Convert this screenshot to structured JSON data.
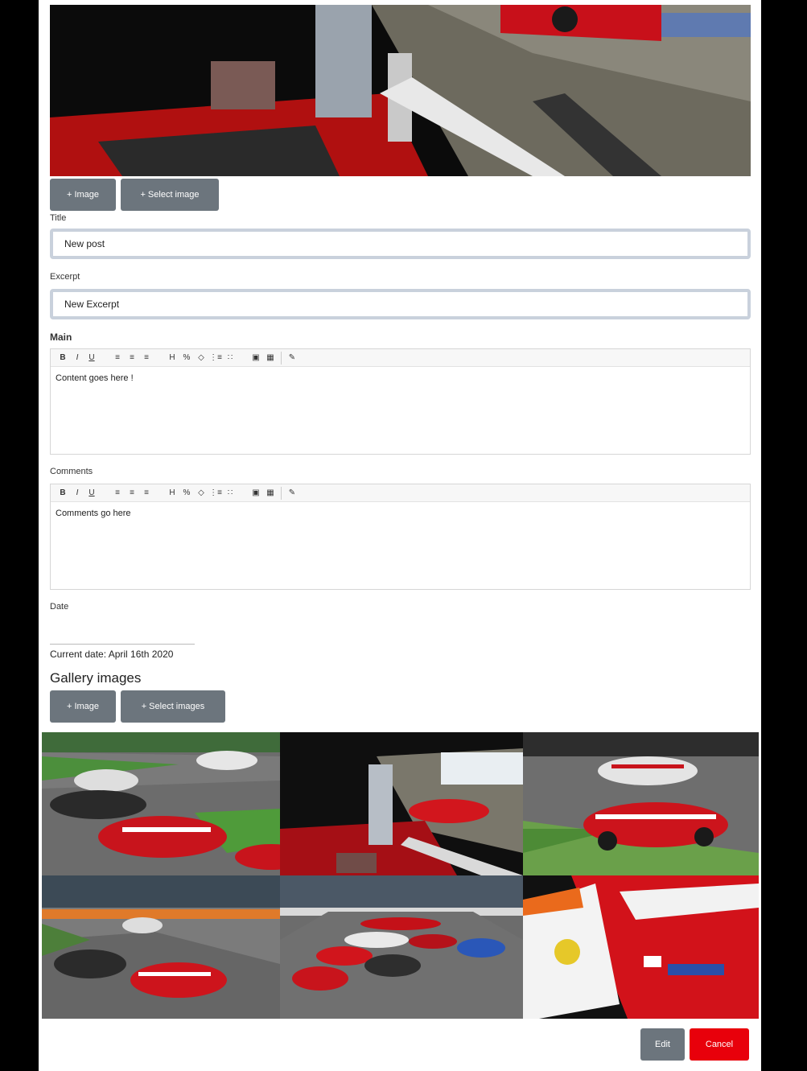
{
  "hero": {
    "alt": "pit-lane-photo"
  },
  "image_buttons": {
    "add_image": "+ Image",
    "select_image": "+ Select image"
  },
  "fields": {
    "title": {
      "label": "Title",
      "value": "New post"
    },
    "excerpt": {
      "label": "Excerpt",
      "value": "New Excerpt"
    }
  },
  "main_editor": {
    "label": "Main",
    "content": "Content goes here !"
  },
  "comments_editor": {
    "label": "Comments",
    "content": "Comments go here"
  },
  "toolbar_icons": [
    "bold",
    "italic",
    "underline",
    "align-left",
    "align-center",
    "align-right",
    "heading",
    "link",
    "code",
    "ordered-list",
    "unordered-list",
    "image",
    "table",
    "eraser"
  ],
  "toolbar_glyphs": {
    "bold": "B",
    "italic": "I",
    "underline": "U",
    "align-left": "≡",
    "align-center": "≡",
    "align-right": "≡",
    "heading": "H",
    "link": "%",
    "code": "◇",
    "ordered-list": "⋮≡",
    "unordered-list": "∷",
    "image": "▣",
    "table": "▦",
    "eraser": "✎"
  },
  "date": {
    "label": "Date",
    "current": "Current date: April 16th 2020"
  },
  "gallery": {
    "title": "Gallery images",
    "add_image": "+ Image",
    "select_images": "+ Select images"
  },
  "footer": {
    "edit": "Edit",
    "cancel": "Cancel"
  },
  "colors": {
    "button_gray": "#6c757d",
    "cancel_red": "#e8000b",
    "input_border": "#c9d1dc"
  }
}
